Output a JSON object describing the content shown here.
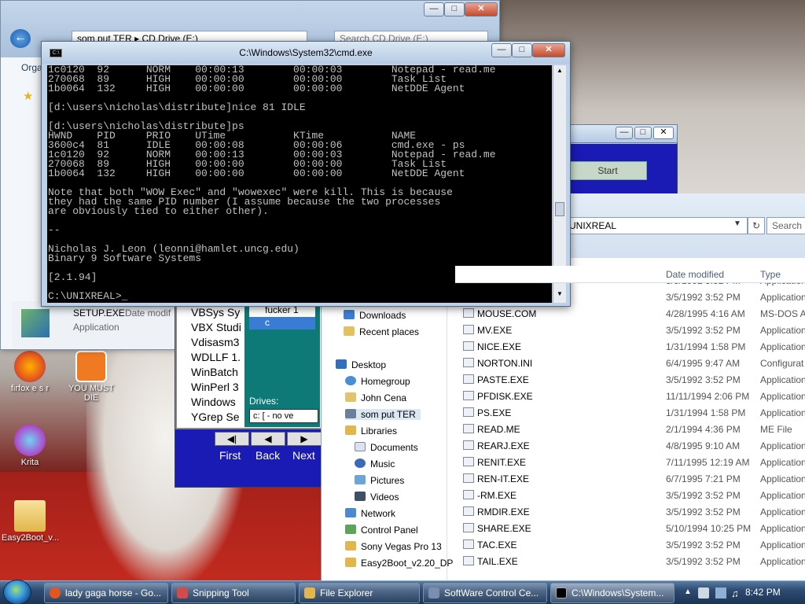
{
  "desktop": {
    "icons": [
      {
        "label": "firfox e s r",
        "icon": "firefox-icon"
      },
      {
        "label": "YOU MUST DIE",
        "icon": "document-icon"
      },
      {
        "label": "Krita",
        "icon": "krita-icon"
      },
      {
        "label": "Easy2Boot_v...",
        "icon": "folder-icon"
      }
    ]
  },
  "explorer_back": {
    "breadcrumb": [
      "som put TER",
      "CD Drive (E:)"
    ],
    "search_placeholder": "Search CD Drive (E:)",
    "organize_label": "Orga",
    "setup_file": {
      "name": "SETUP.EXE",
      "meta": "Date modif",
      "type": "Application"
    }
  },
  "cmd": {
    "title": "C:\\Windows\\System32\\cmd.exe",
    "lines": [
      "1c0120  92      NORM    00:00:13        00:00:03        Notepad - read.me",
      "270068  89      HIGH    00:00:00        00:00:00        Task List",
      "1b0064  132     HIGH    00:00:00        00:00:00        NetDDE Agent",
      "",
      "[d:\\users\\nicholas\\distribute]nice 81 IDLE",
      "",
      "[d:\\users\\nicholas\\distribute]ps",
      "HWND    PID     PRIO    UTime           KTime           NAME",
      "3600c4  81      IDLE    00:00:08        00:00:06        cmd.exe - ps",
      "1c0120  92      NORM    00:00:13        00:00:03        Notepad - read.me",
      "270068  89      HIGH    00:00:00        00:00:00        Task List",
      "1b0064  132     HIGH    00:00:00        00:00:00        NetDDE Agent",
      "",
      "Note that both \"WOW Exec\" and \"wowexec\" were kill. This is because",
      "they had the same PID number (I assume because the two processes",
      "are obviously tied to either other).",
      "",
      "--",
      "",
      "Nicholas J. Leon (leonni@hamlet.uncg.edu)",
      "Binary 9 Software Systems",
      "",
      "[2.1.94]",
      "",
      "C:\\UNIXREAL>_"
    ]
  },
  "scc": {
    "list_items": [
      "VBSys Sy",
      "VBX Studi",
      "Vdisasm3",
      "WDLLF 1.",
      "WinBatch",
      "WinPerl 3",
      "Windows",
      "YGrep Se"
    ],
    "dir_items": [
      "fucker 1",
      "c"
    ],
    "drives_label": "Drives:",
    "drive_value": "c: [ - no ve",
    "nav": [
      "First",
      "Back",
      "Next"
    ],
    "button_hint": "Start"
  },
  "explorer_front": {
    "address": "UNIXREAL",
    "search_placeholder": "Search",
    "columns": {
      "date": "Date modified",
      "type": "Type"
    },
    "nav": [
      {
        "label": "Downloads",
        "icon": "download-folder-icon"
      },
      {
        "label": "Recent places",
        "icon": "recent-places-icon"
      },
      {
        "label": "Desktop",
        "icon": "desktop-icon"
      },
      {
        "label": "Homegroup",
        "icon": "homegroup-icon"
      },
      {
        "label": "John Cena",
        "icon": "user-folder-icon"
      },
      {
        "label": "som put TER",
        "icon": "computer-icon"
      },
      {
        "label": "Libraries",
        "icon": "libraries-icon"
      },
      {
        "label": "Documents",
        "icon": "documents-icon"
      },
      {
        "label": "Music",
        "icon": "music-icon"
      },
      {
        "label": "Pictures",
        "icon": "pictures-icon"
      },
      {
        "label": "Videos",
        "icon": "videos-icon"
      },
      {
        "label": "Network",
        "icon": "network-icon"
      },
      {
        "label": "Control Panel",
        "icon": "control-panel-icon"
      },
      {
        "label": "Sony Vegas Pro 13",
        "icon": "folder-icon"
      },
      {
        "label": "Easy2Boot_v2.20_DP",
        "icon": "folder-icon"
      }
    ],
    "files": [
      {
        "name": "",
        "date": "3/5/1992 3:52 PM",
        "type": "Application"
      },
      {
        "name": "",
        "date": "3/5/1992 3:52 PM",
        "type": "Application"
      },
      {
        "name": "MOUSE.COM",
        "date": "4/28/1995 4:16 AM",
        "type": "MS-DOS Ap"
      },
      {
        "name": "MV.EXE",
        "date": "3/5/1992 3:52 PM",
        "type": "Application"
      },
      {
        "name": "NICE.EXE",
        "date": "1/31/1994 1:58 PM",
        "type": "Application"
      },
      {
        "name": "NORTON.INI",
        "date": "6/4/1995 9:47 AM",
        "type": "Configurat"
      },
      {
        "name": "PASTE.EXE",
        "date": "3/5/1992 3:52 PM",
        "type": "Application"
      },
      {
        "name": "PFDISK.EXE",
        "date": "11/11/1994 2:06 PM",
        "type": "Application"
      },
      {
        "name": "PS.EXE",
        "date": "1/31/1994 1:58 PM",
        "type": "Application"
      },
      {
        "name": "READ.ME",
        "date": "2/1/1994 4:36 PM",
        "type": "ME File"
      },
      {
        "name": "REARJ.EXE",
        "date": "4/8/1995 9:10 AM",
        "type": "Application"
      },
      {
        "name": "RENIT.EXE",
        "date": "7/11/1995 12:19 AM",
        "type": "Application"
      },
      {
        "name": "REN-IT.EXE",
        "date": "6/7/1995 7:21 PM",
        "type": "Application"
      },
      {
        "name": "-RM.EXE",
        "date": "3/5/1992 3:52 PM",
        "type": "Application"
      },
      {
        "name": "RMDIR.EXE",
        "date": "3/5/1992 3:52 PM",
        "type": "Application"
      },
      {
        "name": "SHARE.EXE",
        "date": "5/10/1994 10:25 PM",
        "type": "Application"
      },
      {
        "name": "TAC.EXE",
        "date": "3/5/1992 3:52 PM",
        "type": "Application"
      },
      {
        "name": "TAIL.EXE",
        "date": "3/5/1992 3:52 PM",
        "type": "Application"
      }
    ]
  },
  "taskbar": {
    "buttons": [
      {
        "label": "lady gaga horse - Go...",
        "icon": "firefox-icon"
      },
      {
        "label": "Snipping Tool",
        "icon": "scissors-icon"
      },
      {
        "label": "File Explorer",
        "icon": "folder-icon"
      },
      {
        "label": "SoftWare Control Ce...",
        "icon": "app-icon"
      },
      {
        "label": "C:\\Windows\\System...",
        "icon": "cmd-icon"
      }
    ],
    "clock": "8:42 PM"
  }
}
